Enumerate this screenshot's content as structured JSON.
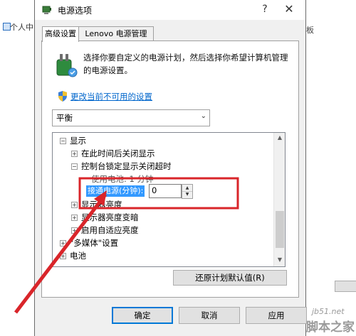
{
  "background": {
    "left_item": "个人中",
    "right_text": "板"
  },
  "window": {
    "title": "电源选项",
    "help_glyph": "?",
    "close_glyph": "✕"
  },
  "tabs": [
    {
      "label": "高级设置"
    },
    {
      "label": "Lenovo 电源管理"
    }
  ],
  "description": "选择你要自定义的电源计划，然后选择你希望计算机管理的电源设置。",
  "change_link": "更改当前不可用的设置",
  "plan": {
    "selected": "平衡"
  },
  "tree": {
    "rows": [
      {
        "exp": "−",
        "label": "显示"
      },
      {
        "exp": "+",
        "label": "在此时间后关闭显示"
      },
      {
        "exp": "−",
        "label": "控制台锁定显示关闭超时"
      },
      {
        "exp": "",
        "label": "使用电池: 1 分钟"
      },
      {
        "exp": "+",
        "label": "显示器亮度"
      },
      {
        "exp": "+",
        "label": "显示器亮度变暗"
      },
      {
        "exp": "+",
        "label": "启用自适应亮度"
      },
      {
        "exp": "+",
        "label": "\"多媒体\"设置"
      },
      {
        "exp": "+",
        "label": "电池"
      }
    ],
    "value_label": "接通电源(分钟):",
    "value": "0",
    "scroll_up": "▲",
    "scroll_down": "▼",
    "spin_up": "▲",
    "spin_down": "▼"
  },
  "restore_button": "还原计划默认值(R)",
  "buttons": {
    "ok": "确定",
    "cancel": "取消",
    "apply": "应用"
  },
  "watermark": {
    "line1": "jb51.net",
    "line2": "脚本之家"
  },
  "colors": {
    "annotation_red": "#d9252a",
    "selection_blue": "#3399ff",
    "link_blue": "#0066cc"
  }
}
